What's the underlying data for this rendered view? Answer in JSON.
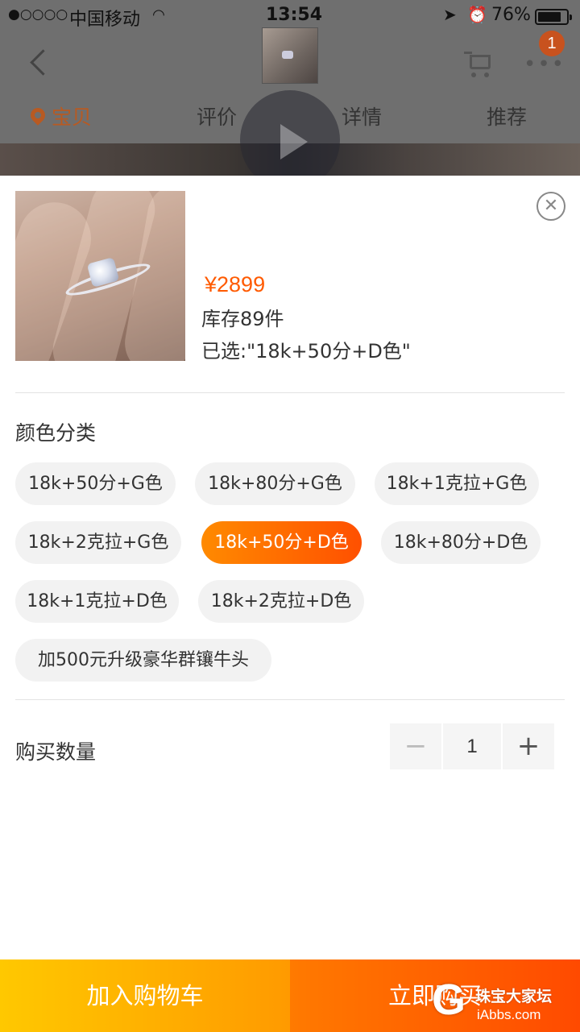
{
  "status_bar": {
    "signal": "●○○○○",
    "carrier": "中国移动",
    "time": "13:54",
    "battery": "76%"
  },
  "header": {
    "badge_count": "1",
    "more": "•••"
  },
  "tabs": [
    {
      "label": "宝贝",
      "active": true
    },
    {
      "label": "评价",
      "active": false
    },
    {
      "label": "详情",
      "active": false
    },
    {
      "label": "推荐",
      "active": false
    }
  ],
  "sku": {
    "price": "¥2899",
    "stock": "库存89件",
    "selected": "已选:\"18k+50分+D色\"",
    "close": "✕"
  },
  "color_section": {
    "title": "颜色分类",
    "options": [
      {
        "label": "18k+50分+G色",
        "selected": false
      },
      {
        "label": "18k+80分+G色",
        "selected": false
      },
      {
        "label": "18k+1克拉+G色",
        "selected": false
      },
      {
        "label": "18k+2克拉+G色",
        "selected": false
      },
      {
        "label": "18k+50分+D色",
        "selected": true
      },
      {
        "label": "18k+80分+D色",
        "selected": false
      },
      {
        "label": "18k+1克拉+D色",
        "selected": false
      },
      {
        "label": "18k+2克拉+D色",
        "selected": false
      },
      {
        "label": "加500元升级豪华群镶牛头",
        "selected": false
      }
    ]
  },
  "quantity": {
    "label": "购买数量",
    "minus": "−",
    "value": "1",
    "plus": "+"
  },
  "actions": {
    "add_to_cart": "加入购物车",
    "buy_now": "立即购买"
  },
  "watermark": {
    "name": "珠宝大家坛",
    "url": "iAbbs.com"
  }
}
